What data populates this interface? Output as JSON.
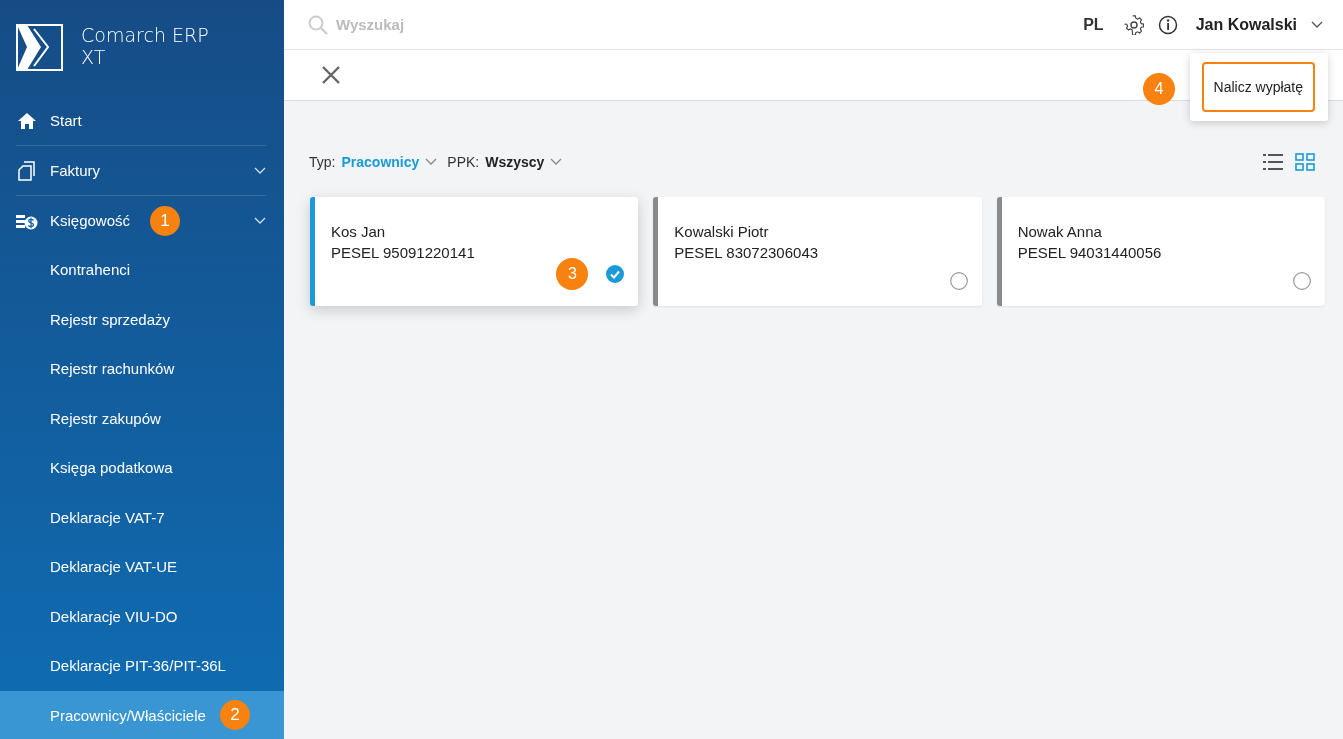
{
  "app": {
    "logo_text": "Comarch ERP XT"
  },
  "sidebar": {
    "items": [
      {
        "label": "Start",
        "kind": "home"
      },
      {
        "label": "Faktury",
        "kind": "invoices",
        "expandable": true
      },
      {
        "label": "Księgowość",
        "kind": "accounting",
        "expandable": true,
        "marker": "1",
        "children": [
          {
            "label": "Kontrahenci",
            "selected": false
          },
          {
            "label": "Rejestr sprzedaży",
            "selected": false
          },
          {
            "label": "Rejestr rachunków",
            "selected": false
          },
          {
            "label": "Rejestr zakupów",
            "selected": false
          },
          {
            "label": "Księga podatkowa",
            "selected": false
          },
          {
            "label": "Deklaracje VAT-7",
            "selected": false
          },
          {
            "label": "Deklaracje VAT-UE",
            "selected": false
          },
          {
            "label": "Deklaracje VIU-DO",
            "selected": false
          },
          {
            "label": "Deklaracje PIT-36/PIT-36L",
            "selected": false
          },
          {
            "label": "Pracownicy/Właściciele",
            "selected": true,
            "marker": "2"
          }
        ]
      }
    ]
  },
  "topbar": {
    "search": {
      "placeholder": "Wyszukaj"
    },
    "language": "PL",
    "user": "Jan Kowalski"
  },
  "toolbar": {
    "action_menu": {
      "button": "Nalicz wypłatę",
      "marker": "4"
    }
  },
  "filters": [
    {
      "label": "Typ:",
      "value": "Pracownicy",
      "highlighted": true
    },
    {
      "label": "PPK:",
      "value": "Wszyscy",
      "highlighted": false
    }
  ],
  "views": [
    {
      "kind": "list",
      "selected": false
    },
    {
      "kind": "grid",
      "selected": true
    }
  ],
  "cards": [
    {
      "name": "Kos Jan",
      "pesel": "PESEL 95091220141",
      "selected": true,
      "marker": "3"
    },
    {
      "name": "Kowalski Piotr",
      "pesel": "PESEL 83072306043",
      "selected": false
    },
    {
      "name": "Nowak Anna",
      "pesel": "PESEL 94031440056",
      "selected": false
    }
  ]
}
